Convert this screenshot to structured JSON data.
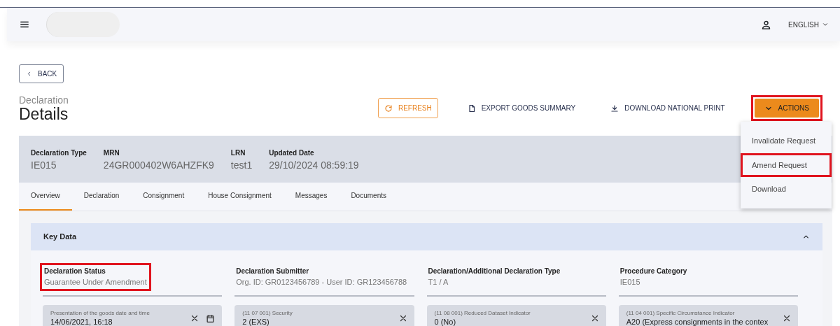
{
  "header": {
    "language": "ENGLISH"
  },
  "back_button": "BACK",
  "page": {
    "subtitle": "Declaration",
    "title": "Details"
  },
  "toolbar": [
    {
      "kind": "outline",
      "label": "REFRESH",
      "highlighted": false
    },
    {
      "kind": "text",
      "label": "EXPORT GOODS SUMMARY",
      "highlighted": false
    },
    {
      "kind": "text",
      "label": "DOWNLOAD NATIONAL PRINT",
      "highlighted": false
    },
    {
      "kind": "dropdown",
      "label": "ACTIONS",
      "highlighted": true,
      "expanded": true
    }
  ],
  "actions_menu": [
    {
      "label": "Invalidate Request",
      "highlighted": false
    },
    {
      "label": "Amend Request",
      "highlighted": true
    },
    {
      "label": "Download",
      "highlighted": false
    }
  ],
  "summary": [
    {
      "label": "Declaration Type",
      "value": "IE015"
    },
    {
      "label": "MRN",
      "value": "24GR000402W6AHZFK9"
    },
    {
      "label": "LRN",
      "value": "test1"
    },
    {
      "label": "Updated Date",
      "value": "29/10/2024 08:59:19"
    }
  ],
  "tabs": [
    {
      "label": "Overview",
      "selected": true
    },
    {
      "label": "Declaration",
      "selected": false
    },
    {
      "label": "Consignment",
      "selected": false
    },
    {
      "label": "House Consignment",
      "selected": false
    },
    {
      "label": "Messages",
      "selected": false
    },
    {
      "label": "Documents",
      "selected": false
    }
  ],
  "key_data": {
    "title": "Key Data",
    "expanded": true,
    "fields": [
      {
        "label": "Declaration Status",
        "value": "Guarantee Under Amendment",
        "highlighted": true
      },
      {
        "label": "Declaration Submitter",
        "value": "Org. ID: GR0123456789 - User ID: GR123456788",
        "highlighted": false
      },
      {
        "label": "Declaration/Additional Declaration Type",
        "value": "T1 / A",
        "highlighted": false
      },
      {
        "label": "Procedure Category",
        "value": "IE015",
        "highlighted": false
      }
    ],
    "inputs": [
      {
        "kind": "date",
        "label": "Presentation of the goods date and time",
        "value": "14/06/2021, 16:18"
      },
      {
        "kind": "select",
        "label": "(11 07 001) Security",
        "value": "2 (EXS)"
      },
      {
        "kind": "select",
        "label": "(11 08 001) Reduced Dataset Indicator",
        "value": "0 (No)"
      },
      {
        "kind": "select",
        "label": "(11 04 001) Specific Circumstance Indicator",
        "value": "A20 (Express consignments in the contex"
      }
    ]
  }
}
